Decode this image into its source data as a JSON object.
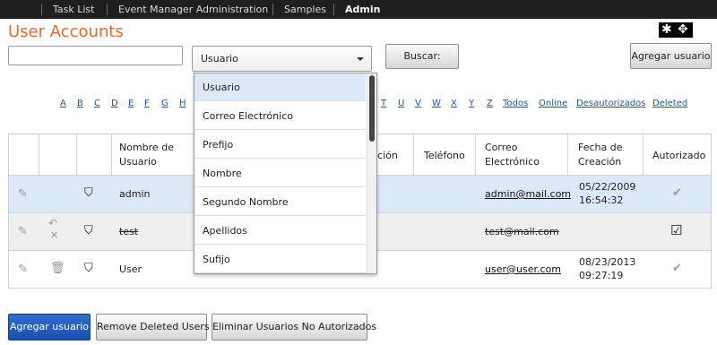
{
  "nav": {
    "items": [
      "Task List",
      "Event Manager Administration",
      "Samples",
      "Admin"
    ],
    "active": "Admin"
  },
  "page_title": "User Accounts",
  "search": {
    "value": "",
    "placeholder": ""
  },
  "filter_select": {
    "value": "Usuario",
    "options": [
      "Usuario",
      "Correo Electrónico",
      "Prefijo",
      "Nombre",
      "Segundo Nombre",
      "Apellidos",
      "Sufijo"
    ]
  },
  "buttons": {
    "search": "Buscar:",
    "add_user_top": "Agregar usuario",
    "add_user_bottom": "Agregar usuario",
    "remove_deleted": "Remove Deleted Users",
    "remove_unauthorized": "Eliminar Usuarios No Autorizados"
  },
  "alpha_filter": {
    "letters_left": [
      "A",
      "B",
      "C",
      "D",
      "E",
      "F",
      "G",
      "H"
    ],
    "letters_right": [
      "T",
      "U",
      "V",
      "W",
      "X",
      "Y",
      "Z"
    ],
    "links": [
      "Todos",
      "Online",
      "Desautorizados",
      "Deleted"
    ]
  },
  "table": {
    "headers": {
      "username": "Nombre de Usuario",
      "address": "cción",
      "phone": "Teléfono",
      "email": "Correo Electrónico",
      "created": "Fecha de Creación",
      "authorized": "Autorizado"
    },
    "rows": [
      {
        "username": "admin",
        "email": "admin@mail.com",
        "date": "05/22/2009",
        "time": "16:54:32",
        "authorized": true,
        "deleted": false
      },
      {
        "username": "test",
        "email": "test@mail.com",
        "date": "",
        "time": "",
        "authorized": true,
        "deleted": true
      },
      {
        "username": "User",
        "email": "user@user.com",
        "date": "08/23/2013",
        "time": "09:27:19",
        "authorized": true,
        "deleted": false
      }
    ]
  },
  "colors": {
    "accent": "#e8692b",
    "link": "#1a56b4",
    "highlight_row": "#dbe8f7",
    "primary_button": "#1a4fa8",
    "topbar": "#1f1f1f"
  }
}
